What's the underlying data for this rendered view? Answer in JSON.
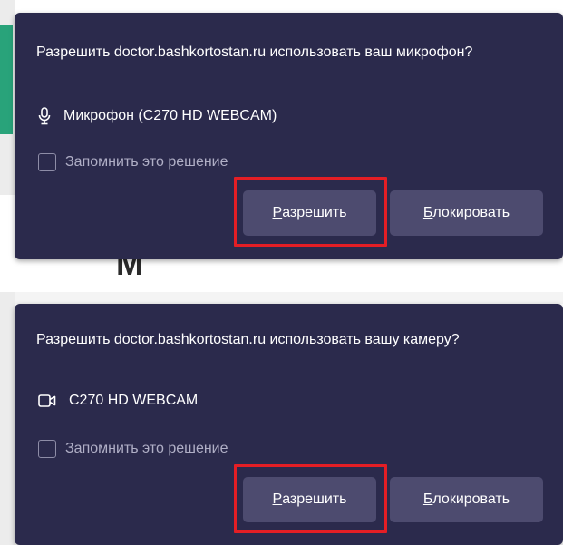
{
  "colors": {
    "panel": "#2b2a4c",
    "button": "#4d4b6f",
    "highlight": "#e41e25",
    "accent": "#29a37a"
  },
  "prompts": [
    {
      "title": "Разрешить doctor.bashkortostan.ru использовать ваш микрофон?",
      "device_icon": "microphone-icon",
      "device_label": "Микрофон (C270 HD WEBCAM)",
      "remember_label": "Запомнить это решение",
      "allow_first": "Р",
      "allow_rest": "азрешить",
      "block_first": "Б",
      "block_rest": "локировать"
    },
    {
      "title": "Разрешить doctor.bashkortostan.ru использовать вашу камеру?",
      "device_icon": "camera-icon",
      "device_label": "C270 HD WEBCAM",
      "remember_label": "Запомнить это решение",
      "allow_first": "Р",
      "allow_rest": "азрешить",
      "block_first": "Б",
      "block_rest": "локировать"
    }
  ]
}
